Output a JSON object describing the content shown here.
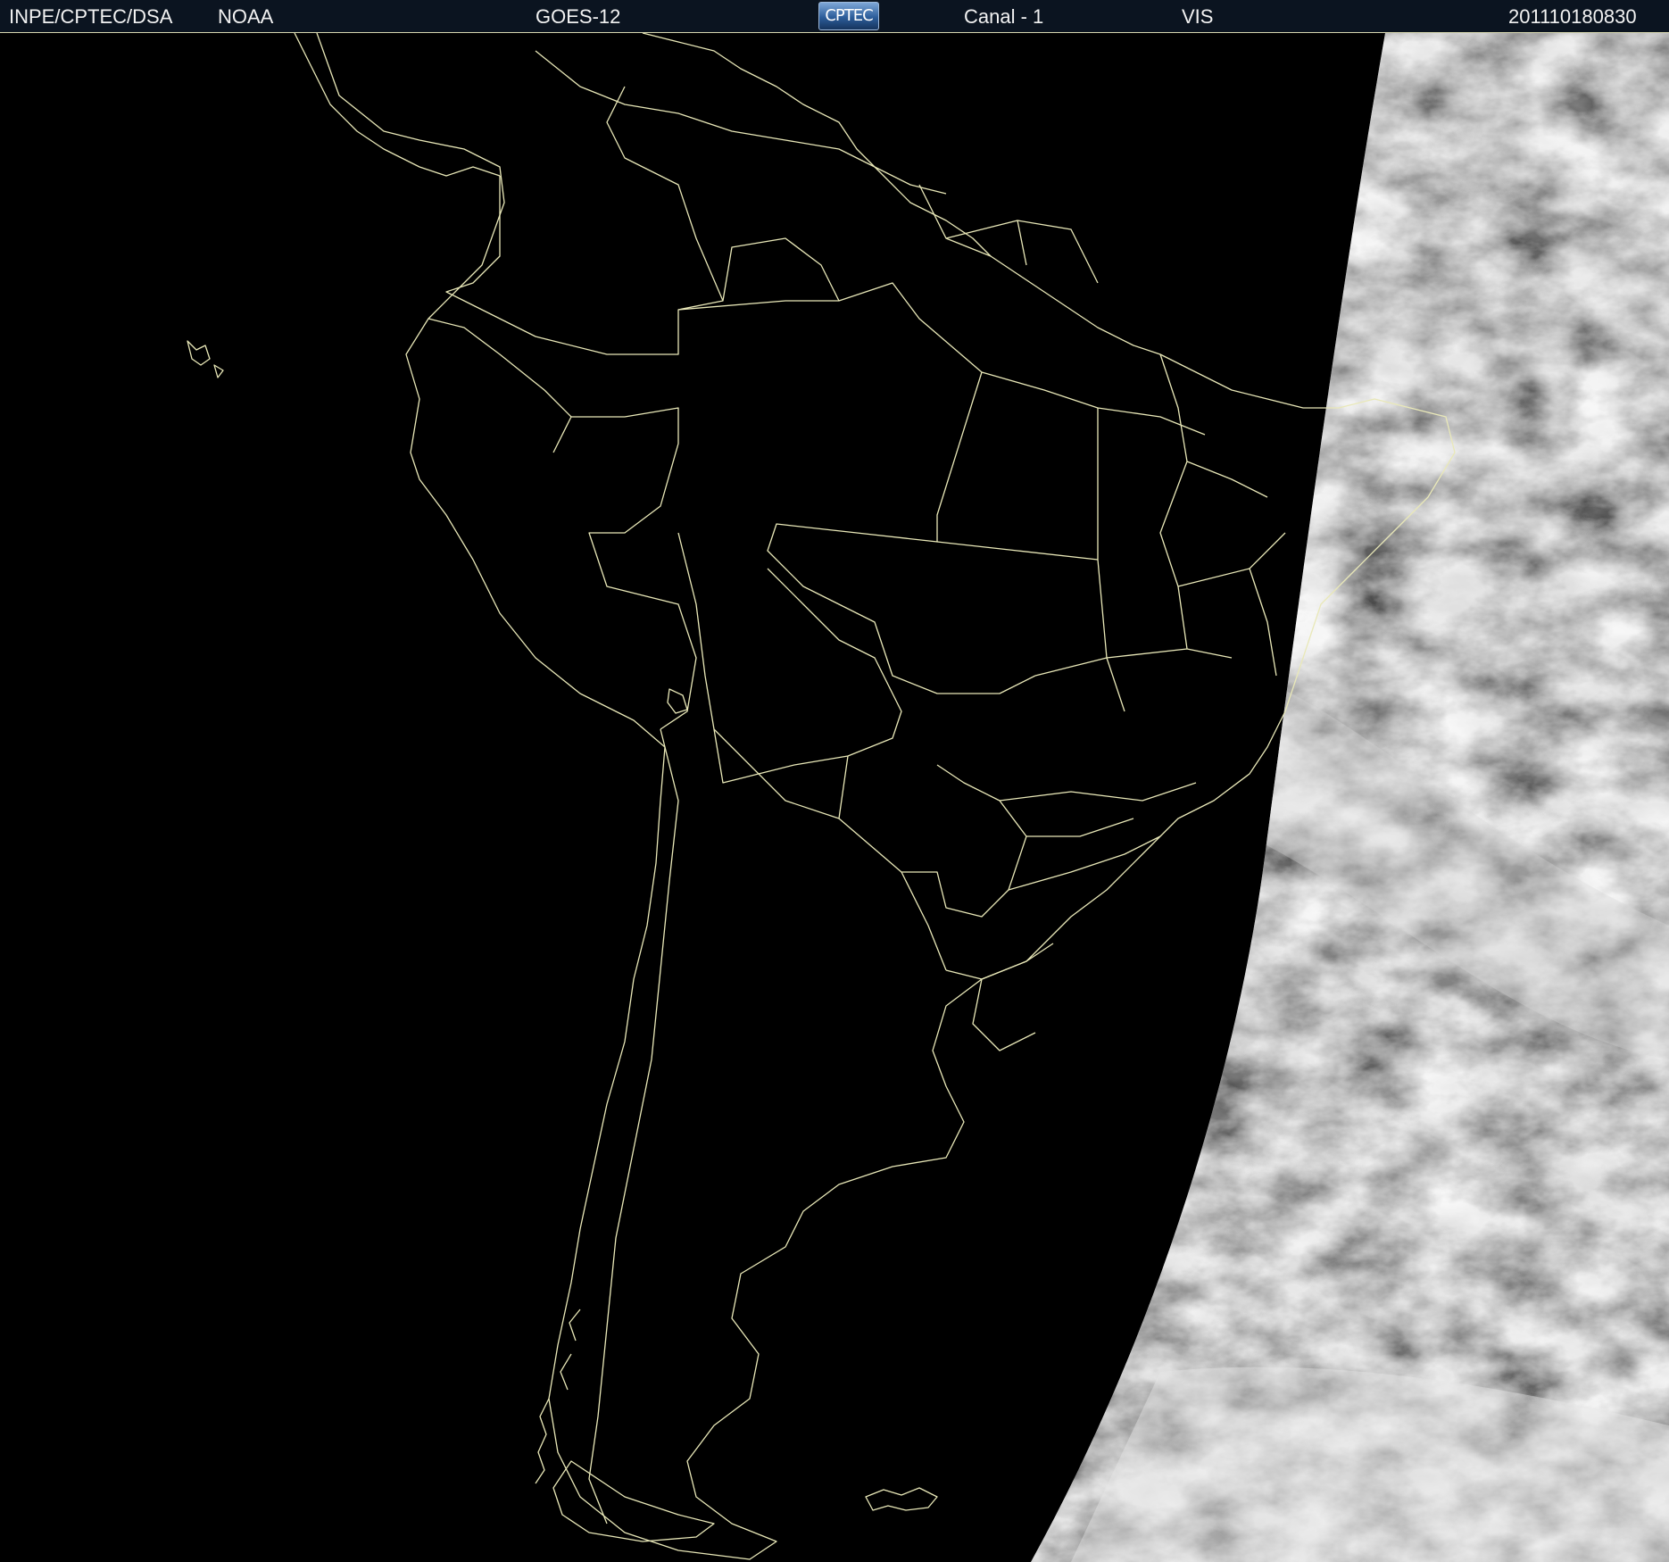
{
  "header": {
    "agency": "INPE/CPTEC/DSA",
    "source": "NOAA",
    "satellite": "GOES-12",
    "logo_text": "CPTEC",
    "channel": "Canal - 1",
    "band": "VIS",
    "timestamp": "201110180830"
  },
  "colors": {
    "header_bg": "#0b1420",
    "header_text": "#f2f2f2",
    "map_background": "#000000",
    "border_lines": "#e9e8b8",
    "cloud_imagery": "#cfcfcf"
  }
}
